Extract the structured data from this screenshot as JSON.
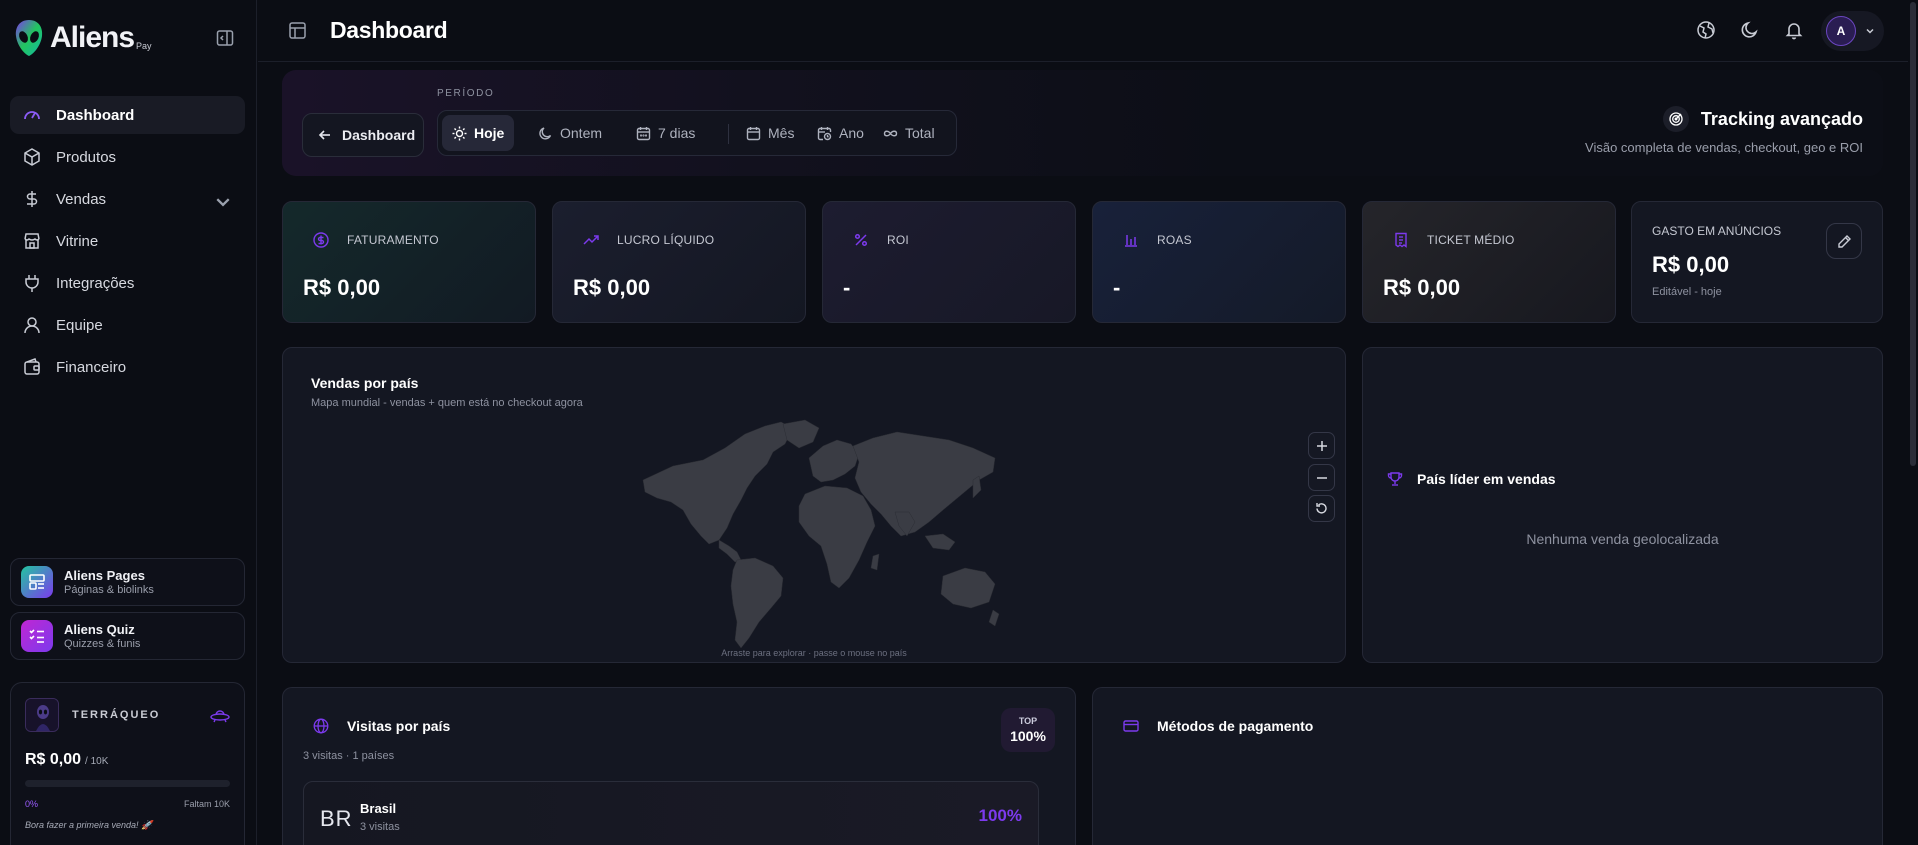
{
  "brand": {
    "name": "Aliens",
    "suffix": "Pay"
  },
  "sidebar": {
    "items": [
      {
        "label": "Dashboard",
        "icon": "gauge-icon",
        "active": true
      },
      {
        "label": "Produtos",
        "icon": "box-icon"
      },
      {
        "label": "Vendas",
        "icon": "dollar-icon",
        "expandable": true
      },
      {
        "label": "Vitrine",
        "icon": "store-icon"
      },
      {
        "label": "Integrações",
        "icon": "plug-icon"
      },
      {
        "label": "Equipe",
        "icon": "user-icon"
      },
      {
        "label": "Financeiro",
        "icon": "wallet-icon"
      }
    ],
    "apps": [
      {
        "title": "Aliens Pages",
        "subtitle": "Páginas & biolinks"
      },
      {
        "title": "Aliens Quiz",
        "subtitle": "Quizzes & funis"
      }
    ],
    "rank": {
      "title": "TERRÁQUEO",
      "value": "R$ 0,00",
      "goal": "/ 10K",
      "progress": 0,
      "percent_label": "0%",
      "remaining_label": "Faltam 10K",
      "message": "Bora fazer a primeira venda! 🚀"
    }
  },
  "header": {
    "title": "Dashboard",
    "avatar_initial": "A"
  },
  "period": {
    "back_label": "Dashboard",
    "label": "PERÍODO",
    "options": [
      {
        "label": "Hoje",
        "icon": "sun-icon",
        "active": true
      },
      {
        "label": "Ontem",
        "icon": "moon-icon"
      },
      {
        "label": "7 dias",
        "icon": "calendar-icon"
      },
      {
        "label": "Mês",
        "icon": "calendar-icon"
      },
      {
        "label": "Ano",
        "icon": "calendar-clock-icon"
      },
      {
        "label": "Total",
        "icon": "infinity-icon"
      }
    ],
    "tracking_title": "Tracking avançado",
    "tracking_subtitle": "Visão completa de vendas, checkout, geo e ROI"
  },
  "kpis": [
    {
      "label": "FATURAMENTO",
      "value": "R$ 0,00",
      "icon": "dollar-circle-icon"
    },
    {
      "label": "LUCRO LÍQUIDO",
      "value": "R$ 0,00",
      "icon": "trending-up-icon"
    },
    {
      "label": "ROI",
      "value": "-",
      "icon": "percent-icon"
    },
    {
      "label": "ROAS",
      "value": "-",
      "icon": "bar-chart-icon"
    },
    {
      "label": "TICKET MÉDIO",
      "value": "R$ 0,00",
      "icon": "receipt-icon"
    }
  ],
  "ad_spend": {
    "label": "GASTO EM ANÚNCIOS",
    "value": "R$ 0,00",
    "note": "Editável - hoje"
  },
  "map_panel": {
    "title": "Vendas por país",
    "subtitle": "Mapa mundial - vendas + quem está no checkout agora",
    "hint": "Arraste para explorar · passe o mouse no país"
  },
  "leader_panel": {
    "title": "País líder em vendas",
    "empty": "Nenhuma venda geolocalizada"
  },
  "visits_panel": {
    "title": "Visitas por país",
    "subtitle": "3 visitas · 1 países",
    "badge_top": "TOP",
    "badge_value": "100%",
    "rows": [
      {
        "code": "BR",
        "name": "Brasil",
        "visits": "3 visitas",
        "share": "100%"
      }
    ]
  },
  "payment_panel": {
    "title": "Métodos de pagamento"
  },
  "colors": {
    "accent": "#8b3dff",
    "background": "#0b0d14",
    "card": "#141722"
  }
}
